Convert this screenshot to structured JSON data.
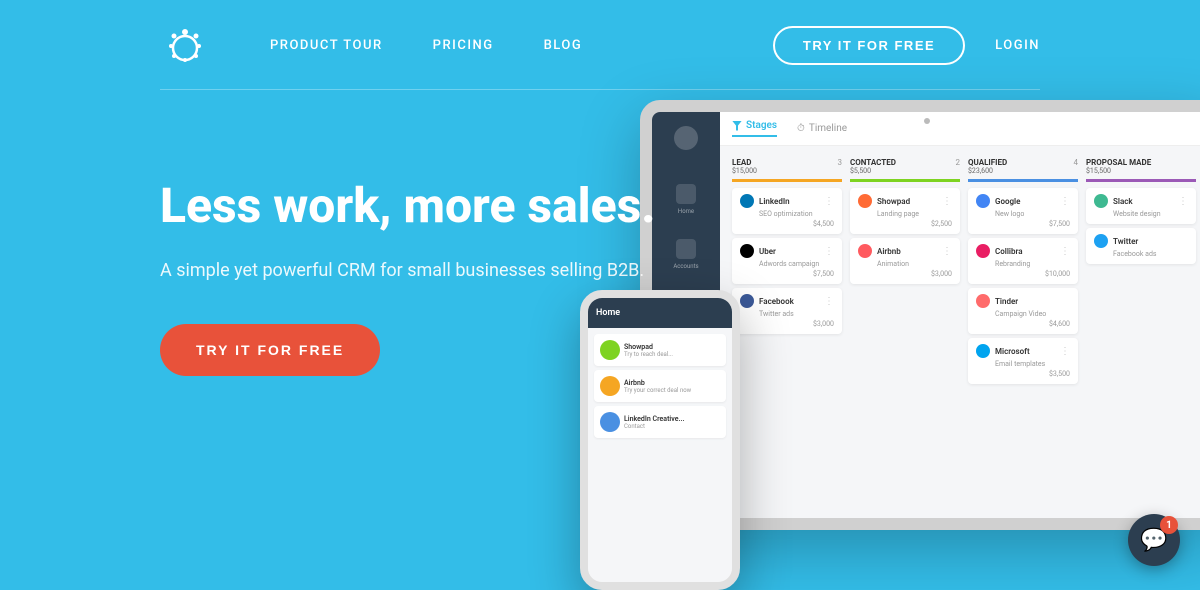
{
  "brand": {
    "name": "Salesflare"
  },
  "navbar": {
    "links": [
      {
        "id": "product-tour",
        "label": "PRODUCT TOUR"
      },
      {
        "id": "pricing",
        "label": "PRICING"
      },
      {
        "id": "blog",
        "label": "BLOG"
      }
    ],
    "cta_label": "TRY IT FOR FREE",
    "login_label": "LOGIN"
  },
  "hero": {
    "title": "Less work, more sales.",
    "subtitle": "A simple yet powerful CRM for small businesses selling B2B.",
    "cta_label": "TRY IT FOR FREE"
  },
  "crm": {
    "tabs": [
      {
        "label": "Stages",
        "active": true
      },
      {
        "label": "Timeline",
        "active": false
      }
    ],
    "columns": [
      {
        "id": "lead",
        "title": "Lead",
        "count": "3",
        "amount": "$15,000",
        "color": "#f5a623",
        "cards": [
          {
            "name": "LinkedIn",
            "desc": "SEO optimization",
            "amount": "$4,500",
            "color": "#0077b5"
          },
          {
            "name": "Uber",
            "desc": "Adwords campaign",
            "amount": "$7,500",
            "color": "#000000"
          },
          {
            "name": "Facebook",
            "desc": "Twitter ads",
            "amount": "$3,000",
            "color": "#3b5998"
          }
        ]
      },
      {
        "id": "contacted",
        "title": "Contacted",
        "count": "2",
        "amount": "$5,500",
        "color": "#7ed321",
        "cards": [
          {
            "name": "Showpad",
            "desc": "Landing page",
            "amount": "$2,500",
            "color": "#ff6b35"
          },
          {
            "name": "Airbnb",
            "desc": "Animation",
            "amount": "$3,000",
            "color": "#ff5a5f"
          }
        ]
      },
      {
        "id": "qualified",
        "title": "Qualified",
        "count": "4",
        "amount": "$23,600",
        "color": "#4a90e2",
        "cards": [
          {
            "name": "Google",
            "desc": "New logo",
            "amount": "$7,500",
            "color": "#4285f4"
          },
          {
            "name": "Collibra",
            "desc": "Rebranding",
            "amount": "$10,000",
            "color": "#e91e63"
          },
          {
            "name": "Tinder",
            "desc": "Campaign Video",
            "amount": "$4,600",
            "color": "#ff6b6b"
          },
          {
            "name": "Microsoft",
            "desc": "Email templates",
            "amount": "$3,500",
            "color": "#00a4ef"
          }
        ]
      },
      {
        "id": "proposal",
        "title": "Proposal made",
        "count": "",
        "amount": "$15,500",
        "color": "#9b59b6",
        "cards": [
          {
            "name": "Slack",
            "desc": "Website design",
            "amount": "",
            "color": "#3eb991"
          },
          {
            "name": "Twitter",
            "desc": "Facebook ads",
            "amount": "",
            "color": "#1da1f2"
          }
        ]
      }
    ]
  },
  "phone": {
    "header": "Home",
    "cards": [
      {
        "name": "Showpad",
        "sub": "Try to reach deal..."
      },
      {
        "name": "Airbnb",
        "sub": "Try your correct deal now"
      },
      {
        "name": "LinkedIn Creative...",
        "sub": "Contact"
      }
    ]
  },
  "chat": {
    "badge": "1"
  }
}
